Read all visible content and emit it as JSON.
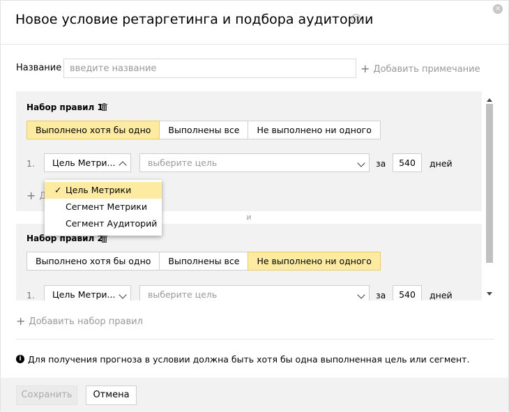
{
  "dialog": {
    "title": "Новое условие ретаргетинга и подбора аудитории",
    "help_symbol": "?",
    "close_symbol": "×"
  },
  "name_field": {
    "label": "Название",
    "placeholder": "введите название",
    "value": ""
  },
  "add_note_label": "Добавить примечание",
  "rule_sets": [
    {
      "title": "Набор правил",
      "index": "1",
      "match_modes": [
        "Выполнено хотя бы одно",
        "Выполнены все",
        "Не выполнено ни одного"
      ],
      "active_mode": "Выполнено хотя бы одно",
      "conditions": [
        {
          "number": "1.",
          "type": "Цель Метри...",
          "goal_placeholder": "выберите цель",
          "period_prefix": "за",
          "days": "540",
          "period_unit": "дней"
        }
      ],
      "add_condition_label": "Д"
    },
    {
      "title": "Набор правил",
      "index": "2",
      "match_modes": [
        "Выполнено хотя бы одно",
        "Выполнены все",
        "Не выполнено ни одного"
      ],
      "active_mode": "Не выполнено ни одного",
      "conditions": [
        {
          "number": "1.",
          "type": "Цель Метри...",
          "goal_placeholder": "выберите цель",
          "period_prefix": "за",
          "days": "540",
          "period_unit": "дней"
        }
      ]
    }
  ],
  "and_separator": "и",
  "type_dropdown": {
    "options": [
      "Цель Метрики",
      "Сегмент Метрики",
      "Сегмент Аудиторий"
    ],
    "selected": "Цель Метрики",
    "check_symbol": "✓"
  },
  "add_ruleset_label": "Добавить набор правил",
  "info": {
    "icon_symbol": "i",
    "text": "Для получения прогноза в условии должна быть хотя бы одна выполненная цель или сегмент."
  },
  "footer": {
    "save_label": "Сохранить",
    "cancel_label": "Отмена"
  },
  "colors": {
    "active_segment": "#fdeba2",
    "panel_background": "#f2f2f2",
    "muted_text": "#999999"
  }
}
